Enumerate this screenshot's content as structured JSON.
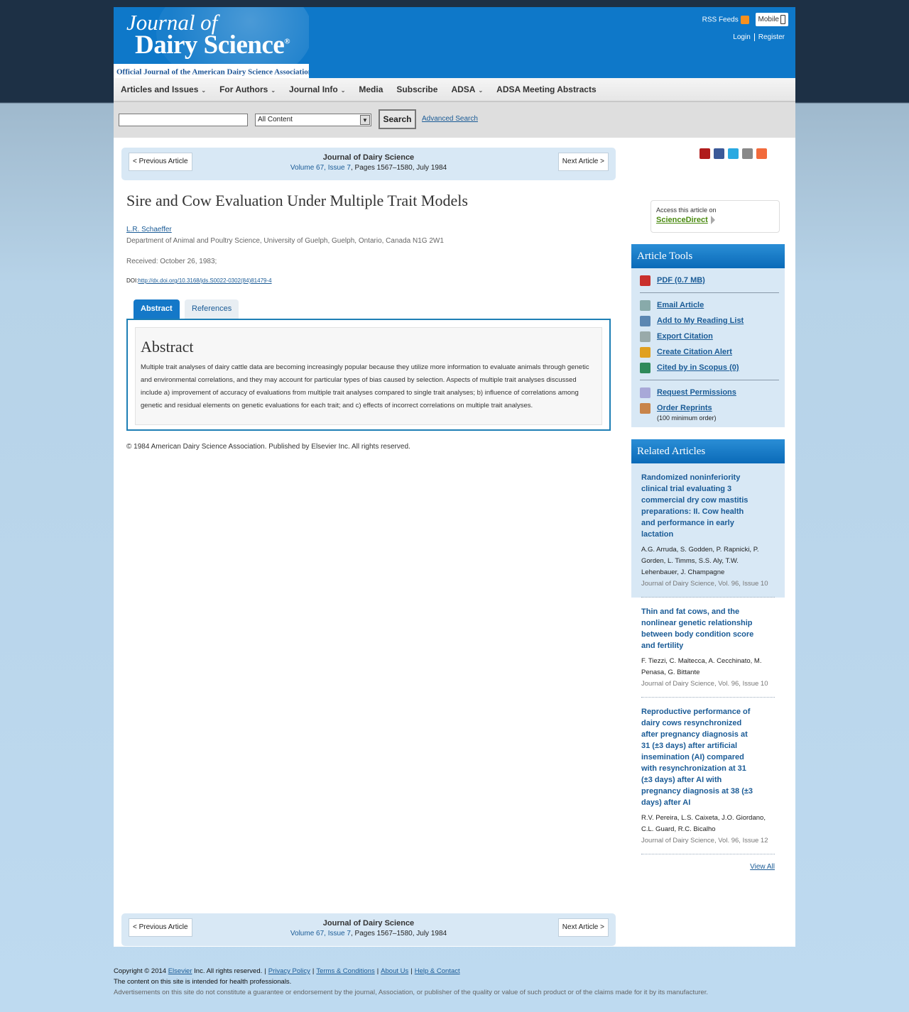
{
  "header": {
    "logo_line1": "Journal of",
    "logo_line2": "Dairy Science",
    "logo_reg": "®",
    "logo_tagline": "Official Journal of the American Dairy Science Association",
    "logo_tagline_reg": "®",
    "rss": "RSS Feeds",
    "mobile": "Mobile",
    "login": "Login",
    "register": "Register"
  },
  "nav": [
    "Articles and Issues",
    "For Authors",
    "Journal Info",
    "Media",
    "Subscribe",
    "ADSA",
    "ADSA Meeting Abstracts"
  ],
  "nav_has_caret": [
    true,
    true,
    true,
    false,
    false,
    true,
    false
  ],
  "search": {
    "placeholder": "",
    "scope": "All Content",
    "button": "Search",
    "advanced": "Advanced Search"
  },
  "article_nav": {
    "prev": "< Previous Article",
    "next": "Next Article >",
    "journal": "Journal of Dairy Science",
    "volume_link": "Volume 67, Issue 7",
    "pages": ", Pages 1567–1580, July 1984"
  },
  "article": {
    "title": "Sire and Cow Evaluation Under Multiple Trait Models",
    "author": "L.R. Schaeffer",
    "affiliation": "Department of Animal and Poultry Science, University of Guelph, Guelph, Ontario, Canada N1G 2W1",
    "received": "Received: October 26, 1983;",
    "doi_label": "DOI:",
    "doi_link": "http://dx.doi.org/10.3168/jds.S0022-0302(84)81479-4",
    "tab_abstract": "Abstract",
    "tab_references": "References",
    "abstract_heading": "Abstract",
    "abstract_text": "Multiple trait analyses of dairy cattle data are becoming increasingly popular because they utilize more information to evaluate animals through genetic and environmental correlations, and they may account for particular types of bias caused by selection. Aspects of multiple trait analyses discussed include a) improvement of accuracy of evaluations from multiple trait analyses compared to single trait analyses; b) influence of correlations among genetic and residual elements on genetic evaluations for each trait; and c) effects of incorrect correlations on multiple trait analyses.",
    "copyright": "© 1984 American Dairy Science Association. Published by Elsevier Inc. All rights reserved."
  },
  "share_icons": [
    "mendeley-icon",
    "facebook-icon",
    "twitter-icon",
    "email-icon",
    "addthis-icon"
  ],
  "share_colors": [
    "#b01c1c",
    "#3b5998",
    "#29a9e1",
    "#888888",
    "#f26a3b"
  ],
  "sciencedirect": {
    "line1": "Access this article on",
    "line2": "ScienceDirect"
  },
  "article_tools": {
    "heading": "Article Tools",
    "pdf": "PDF (0.7 MB)",
    "email": "Email Article",
    "reading_list": "Add to My Reading List",
    "export": "Export Citation",
    "alert": "Create Citation Alert",
    "scopus": "Cited by in Scopus (0)",
    "permissions": "Request Permissions",
    "reprints": "Order Reprints",
    "reprints_note": "(100 minimum order)"
  },
  "related": {
    "heading": "Related Articles",
    "items": [
      {
        "title": "Randomized noninferiority clinical trial evaluating 3 commercial dry cow mastitis preparations: II. Cow health and performance in early lactation",
        "authors": "A.G. Arruda, S. Godden, P. Rapnicki, P. Gorden, L. Timms, S.S. Aly, T.W. Lehenbauer, J. Champagne",
        "journal": "Journal of Dairy Science, Vol. 96, Issue 10"
      },
      {
        "title": "Thin and fat cows, and the nonlinear genetic relationship between body condition score and fertility",
        "authors": "F. Tiezzi, C. Maltecca, A. Cecchinato, M. Penasa, G. Bittante",
        "journal": "Journal of Dairy Science, Vol. 96, Issue 10"
      },
      {
        "title": "Reproductive performance of dairy cows resynchronized after pregnancy diagnosis at 31 (±3 days) after artificial insemination (AI) compared with resynchronization at 31 (±3 days) after AI with pregnancy diagnosis at 38 (±3 days) after AI",
        "authors": "R.V. Pereira, L.S. Caixeta, J.O. Giordano, C.L. Guard, R.C. Bicalho",
        "journal": "Journal of Dairy Science, Vol. 96, Issue 12"
      }
    ],
    "view_all": "View All"
  },
  "footer": {
    "copyright_pre": "Copyright © 2014",
    "elsevier": "Elsevier",
    "copyright_post": "Inc. All rights reserved.",
    "privacy": "Privacy Policy",
    "terms": "Terms & Conditions",
    "about": "About Us",
    "help": "Help & Contact",
    "line2": "The content on this site is intended for health professionals.",
    "line3": "Advertisements on this site do not constitute a guarantee or endorsement by the journal, Association, or publisher of the quality or value of such product or of the claims made for it by its manufacturer."
  }
}
